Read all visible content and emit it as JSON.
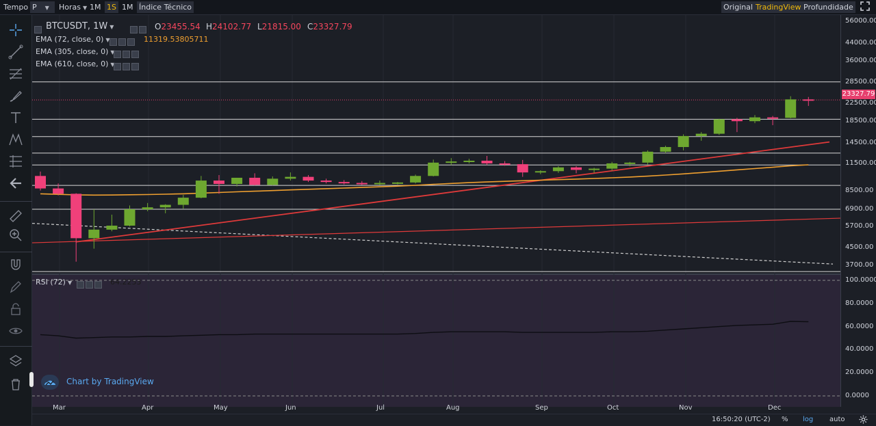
{
  "toolbar": {
    "tempo": "Tempo",
    "period_select": "P",
    "horas": "Horas",
    "btn_1m": "1M",
    "btn_1s": "1S",
    "btn_1mo": "1M",
    "indicators": "Índice Técnico",
    "original": "Original",
    "tradingview": "TradingView",
    "profundidade": "Profundidade"
  },
  "legend": {
    "symbol": "BTCUSDT, 1W",
    "o_key": "O",
    "o_val": "23455.54",
    "h_key": "H",
    "h_val": "24102.77",
    "l_key": "L",
    "l_val": "21815.00",
    "c_key": "C",
    "c_val": "23327.79",
    "ema1": "EMA (72, close, 0)",
    "ema1_val": "11319.53805711",
    "ema2": "EMA (305, close, 0)",
    "ema3": "EMA (610, close, 0)",
    "rsi": "RSI (72)",
    "rsi_val": "64.2253"
  },
  "price_axis": {
    "labels": [
      "56000.00",
      "44000.00",
      "36000.00",
      "28500.00",
      "22500.00",
      "18500.00",
      "14500.00",
      "11500.00",
      "8500.00",
      "6900.00",
      "5700.00",
      "4500.00",
      "3700.00"
    ],
    "current": "23327.79",
    "rsi_labels": [
      "100.0000",
      "80.0000",
      "60.0000",
      "40.0000",
      "20.0000",
      "0.0000"
    ]
  },
  "time_axis": {
    "labels": [
      "Mar",
      "Apr",
      "May",
      "Jun",
      "Jul",
      "Aug",
      "Sep",
      "Oct",
      "Nov",
      "Dec"
    ]
  },
  "bottom": {
    "time": "16:50:20 (UTC-2)",
    "percent": "%",
    "log": "log",
    "auto": "auto"
  },
  "watermark": "Chart by TradingView",
  "colors": {
    "up": "#6ea830",
    "down": "#f0407a",
    "ema_orange": "#f0a030",
    "trend_red": "#e03a3a",
    "rsi_bg": "#2b2537",
    "bg": "#1c1f26",
    "accent": "#f0b90b"
  },
  "chart_data": {
    "type": "candlestick",
    "timeframe": "1W",
    "scale": "log",
    "ylim": [
      3400,
      60000
    ],
    "candles": [
      {
        "o": 10000,
        "h": 10500,
        "l": 8500,
        "c": 8700
      },
      {
        "o": 8700,
        "h": 9200,
        "l": 8050,
        "c": 8200
      },
      {
        "o": 8200,
        "h": 8250,
        "l": 3850,
        "c": 5000
      },
      {
        "o": 5000,
        "h": 6900,
        "l": 4450,
        "c": 5500
      },
      {
        "o": 5500,
        "h": 6500,
        "l": 5400,
        "c": 5750
      },
      {
        "o": 5750,
        "h": 7200,
        "l": 5700,
        "c": 6900
      },
      {
        "o": 6900,
        "h": 7400,
        "l": 6750,
        "c": 7050
      },
      {
        "o": 7050,
        "h": 7300,
        "l": 6600,
        "c": 7250
      },
      {
        "o": 7250,
        "h": 8100,
        "l": 6950,
        "c": 7850
      },
      {
        "o": 7850,
        "h": 10000,
        "l": 7800,
        "c": 9500
      },
      {
        "o": 9500,
        "h": 10100,
        "l": 8200,
        "c": 9150
      },
      {
        "o": 9150,
        "h": 9800,
        "l": 8900,
        "c": 9800
      },
      {
        "o": 9800,
        "h": 10300,
        "l": 9000,
        "c": 9050
      },
      {
        "o": 9050,
        "h": 9950,
        "l": 9000,
        "c": 9700
      },
      {
        "o": 9700,
        "h": 10400,
        "l": 9500,
        "c": 9900
      },
      {
        "o": 9900,
        "h": 10100,
        "l": 9350,
        "c": 9500
      },
      {
        "o": 9500,
        "h": 9700,
        "l": 9200,
        "c": 9350
      },
      {
        "o": 9350,
        "h": 9550,
        "l": 9100,
        "c": 9250
      },
      {
        "o": 9250,
        "h": 9450,
        "l": 9050,
        "c": 9150
      },
      {
        "o": 9150,
        "h": 9500,
        "l": 9050,
        "c": 9250
      },
      {
        "o": 9250,
        "h": 9350,
        "l": 9100,
        "c": 9300
      },
      {
        "o": 9300,
        "h": 10150,
        "l": 9200,
        "c": 10000
      },
      {
        "o": 10000,
        "h": 12000,
        "l": 9950,
        "c": 11600
      },
      {
        "o": 11600,
        "h": 12200,
        "l": 11300,
        "c": 11750
      },
      {
        "o": 11750,
        "h": 12100,
        "l": 11500,
        "c": 11850
      },
      {
        "o": 11850,
        "h": 12500,
        "l": 11300,
        "c": 11500
      },
      {
        "o": 11500,
        "h": 11800,
        "l": 11200,
        "c": 11400
      },
      {
        "o": 11400,
        "h": 11950,
        "l": 9900,
        "c": 10400
      },
      {
        "o": 10400,
        "h": 10650,
        "l": 10200,
        "c": 10550
      },
      {
        "o": 10550,
        "h": 11150,
        "l": 10350,
        "c": 11000
      },
      {
        "o": 11000,
        "h": 11150,
        "l": 10300,
        "c": 10700
      },
      {
        "o": 10700,
        "h": 10950,
        "l": 10350,
        "c": 10850
      },
      {
        "o": 10850,
        "h": 11700,
        "l": 10600,
        "c": 11500
      },
      {
        "o": 11500,
        "h": 11700,
        "l": 11150,
        "c": 11600
      },
      {
        "o": 11600,
        "h": 13300,
        "l": 11350,
        "c": 13100
      },
      {
        "o": 13100,
        "h": 14000,
        "l": 12900,
        "c": 13800
      },
      {
        "o": 13800,
        "h": 15900,
        "l": 13300,
        "c": 15600
      },
      {
        "o": 15600,
        "h": 16300,
        "l": 14800,
        "c": 16000
      },
      {
        "o": 16000,
        "h": 18900,
        "l": 15800,
        "c": 18800
      },
      {
        "o": 18800,
        "h": 19100,
        "l": 16300,
        "c": 18400
      },
      {
        "o": 18400,
        "h": 19700,
        "l": 18000,
        "c": 19200
      },
      {
        "o": 19200,
        "h": 19500,
        "l": 17600,
        "c": 19100
      },
      {
        "o": 19100,
        "h": 24300,
        "l": 19000,
        "c": 23455
      },
      {
        "o": 23455,
        "h": 24102,
        "l": 21815,
        "c": 23327
      }
    ],
    "ema72": [
      8200,
      8150,
      8100,
      8080,
      8090,
      8110,
      8130,
      8160,
      8200,
      8260,
      8320,
      8380,
      8440,
      8500,
      8560,
      8620,
      8680,
      8740,
      8800,
      8860,
      8930,
      9010,
      9110,
      9200,
      9280,
      9350,
      9420,
      9480,
      9540,
      9600,
      9660,
      9720,
      9800,
      9880,
      9980,
      10100,
      10230,
      10380,
      10540,
      10700,
      10860,
      11020,
      11200,
      11319
    ],
    "rsi": [
      53,
      52,
      50,
      50.5,
      51,
      51,
      51.5,
      51.5,
      52,
      52.5,
      53,
      53,
      53.5,
      53.5,
      53.5,
      53.5,
      53.5,
      53.5,
      53.5,
      53.5,
      53.5,
      54,
      55,
      55.5,
      55.5,
      55.5,
      55.5,
      55,
      55,
      55,
      55,
      55,
      55.5,
      55.5,
      56,
      57,
      58,
      59,
      60,
      61,
      61.5,
      62,
      64.5,
      64.2
    ],
    "horizontal_levels": [
      28500,
      18800,
      15500,
      12900,
      11300,
      9000,
      6900,
      3450
    ],
    "rsi_range": [
      0,
      100
    ]
  }
}
